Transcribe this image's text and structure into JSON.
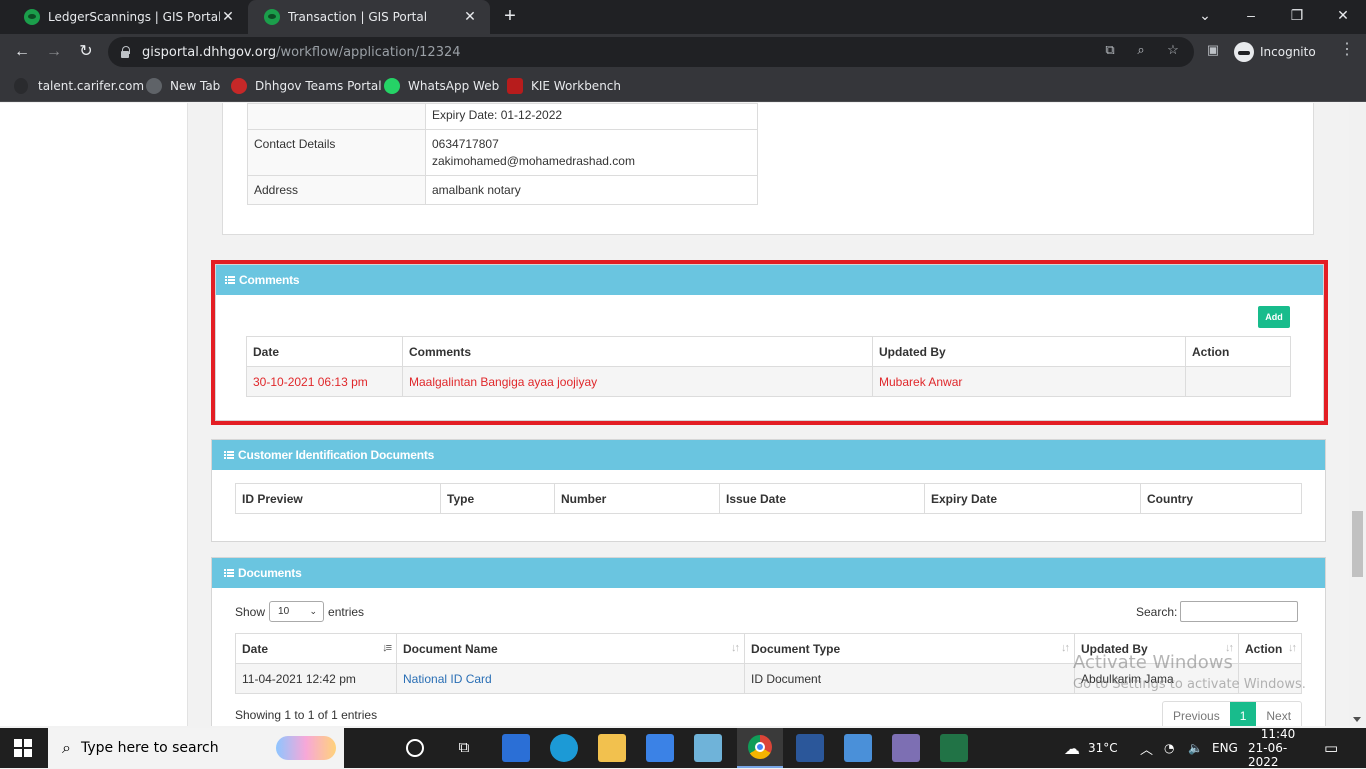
{
  "browser": {
    "tabs": [
      {
        "title": "LedgerScannings | GIS Portal"
      },
      {
        "title": "Transaction | GIS Portal"
      }
    ],
    "url_host": "gisportal.dhhgov.org",
    "url_path": "/workflow/application/12324",
    "profile_label": "Incognito",
    "bookmarks": [
      "talent.carifer.com",
      "New Tab",
      "Dhhgov Teams Portal",
      "WhatsApp Web",
      "KIE Workbench"
    ]
  },
  "details": {
    "expiry_value": "Expiry Date: 01-12-2022",
    "contact_label": "Contact Details",
    "contact_phone": "0634717807",
    "contact_email": "zakimohamed@mohamedrashad.com",
    "address_label": "Address",
    "address_value": "amalbank notary"
  },
  "comments": {
    "title": "Comments",
    "add_label": "Add",
    "headers": [
      "Date",
      "Comments",
      "Updated By",
      "Action"
    ],
    "rows": [
      {
        "date": "30-10-2021 06:13 pm",
        "comment": "Maalgalintan Bangiga ayaa joojiyay",
        "updated_by": "Mubarek Anwar",
        "action": ""
      }
    ]
  },
  "customer_docs": {
    "title": "Customer Identification Documents",
    "headers": [
      "ID Preview",
      "Type",
      "Number",
      "Issue Date",
      "Expiry Date",
      "Country"
    ]
  },
  "documents": {
    "title": "Documents",
    "show_label": "Show",
    "entries_value": "10",
    "entries_label": "entries",
    "search_label": "Search:",
    "headers": [
      "Date",
      "Document Name",
      "Document Type",
      "Updated By",
      "Action"
    ],
    "rows": [
      {
        "date": "11-04-2021 12:42 pm",
        "name": "National ID Card",
        "type": "ID Document",
        "updated_by": "Abdulkarim Jama",
        "action": ""
      }
    ],
    "info": "Showing 1 to 1 of 1 entries",
    "prev_label": "Previous",
    "page": "1",
    "next_label": "Next"
  },
  "watermark": {
    "line1": "Activate Windows",
    "line2": "Go to Settings to activate Windows."
  },
  "taskbar": {
    "search_placeholder": "Type here to search",
    "weather": "31°C",
    "lang": "ENG",
    "time": "11:40",
    "date": "21-06-2022"
  },
  "colors": {
    "panel_header": "#6ac5e0",
    "highlight_border": "#e31e24",
    "add_button": "#18bc8c",
    "comment_text": "#e0282b"
  }
}
